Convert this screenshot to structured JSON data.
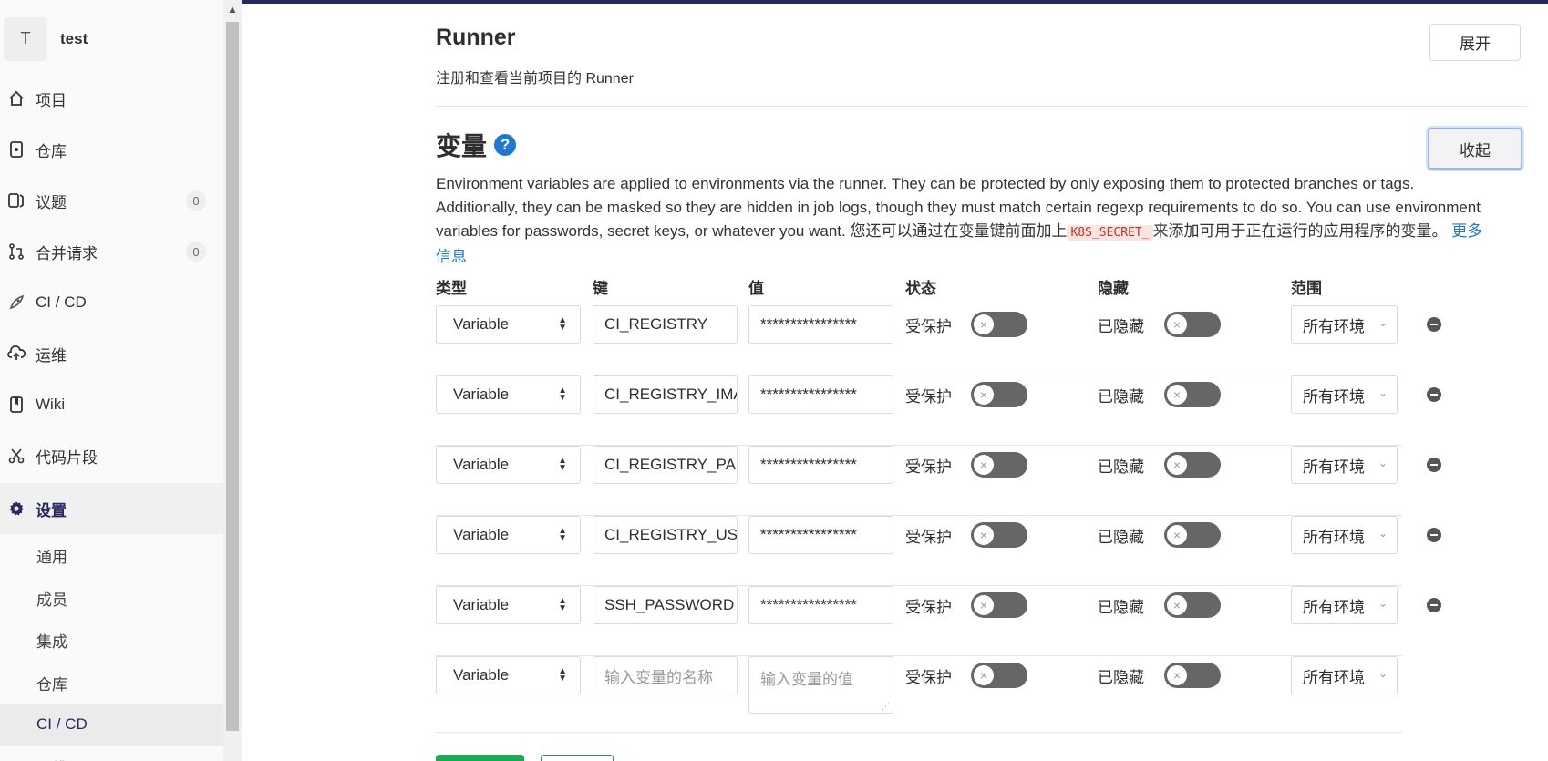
{
  "sidebar": {
    "context": {
      "avatar_letter": "T",
      "name": "test"
    },
    "items": [
      {
        "label": "项目",
        "icon": "home-icon"
      },
      {
        "label": "仓库",
        "icon": "doc-icon"
      },
      {
        "label": "议题",
        "icon": "issues-icon",
        "badge": "0"
      },
      {
        "label": "合并请求",
        "icon": "merge-request-icon",
        "badge": "0"
      },
      {
        "label": "CI / CD",
        "icon": "rocket-icon"
      },
      {
        "label": "运维",
        "icon": "cloud-icon"
      },
      {
        "label": "Wiki",
        "icon": "book-icon"
      },
      {
        "label": "代码片段",
        "icon": "scissors-icon"
      },
      {
        "label": "设置",
        "icon": "gear-icon"
      }
    ],
    "settings_sub": [
      "通用",
      "成员",
      "集成",
      "仓库",
      "CI / CD",
      "运维"
    ]
  },
  "runner": {
    "title": "Runner",
    "description": "注册和查看当前项目的 Runner",
    "expand_label": "展开"
  },
  "variables": {
    "title": "变量",
    "collapse_label": "收起",
    "desc_part1": "Environment variables are applied to environments via the runner. They can be protected by only exposing them to protected branches or tags. Additionally, they can be masked so they are hidden in job logs, though they must match certain regexp requirements to do so. You can use environment variables for passwords, secret keys, or whatever you want. 您还可以通过在变量键前面加上",
    "code": "K8S_SECRET_",
    "desc_part2": "来添加可用于正在运行的应用程序的变量。",
    "more_info": "更多信息",
    "headers": {
      "type": "类型",
      "key": "键",
      "value": "值",
      "state": "状态",
      "masked": "隐藏",
      "scope": "范围"
    },
    "protected_label": "受保护",
    "masked_label": "已隐藏",
    "rows": [
      {
        "type": "Variable",
        "key": "CI_REGISTRY",
        "value": "****************",
        "scope": "所有环境"
      },
      {
        "type": "Variable",
        "key": "CI_REGISTRY_IMA",
        "value": "****************",
        "scope": "所有环境"
      },
      {
        "type": "Variable",
        "key": "CI_REGISTRY_PAS",
        "value": "****************",
        "scope": "所有环境"
      },
      {
        "type": "Variable",
        "key": "CI_REGISTRY_USE",
        "value": "****************",
        "scope": "所有环境"
      },
      {
        "type": "Variable",
        "key": "SSH_PASSWORD",
        "value": "****************",
        "scope": "所有环境"
      }
    ],
    "new_row": {
      "type": "Variable",
      "key_placeholder": "输入变量的名称",
      "value_placeholder": "输入变量的值",
      "scope": "所有环境"
    }
  }
}
